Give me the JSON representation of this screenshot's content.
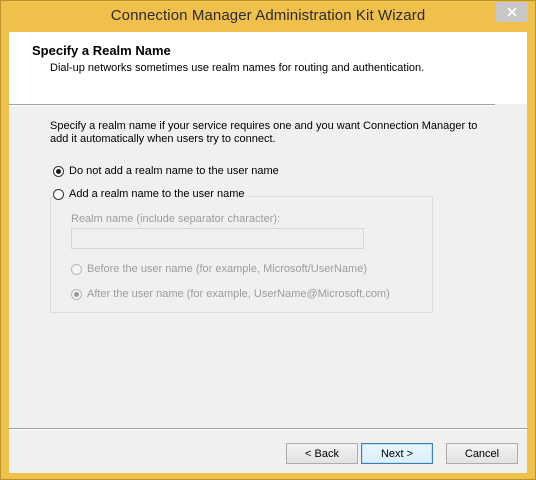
{
  "window": {
    "title": "Connection Manager Administration Kit Wizard",
    "close_symbol": "✕"
  },
  "header": {
    "title": "Specify a Realm Name",
    "subtitle": "Dial-up networks sometimes use realm names for routing and authentication."
  },
  "intro_text": "Specify a realm name if your service requires one and you want Connection Manager to add it automatically when users try to connect.",
  "options": {
    "no_realm": {
      "label": "Do not add a realm name to the user name",
      "checked": true
    },
    "add_realm": {
      "label": "Add a realm name to the user name",
      "checked": false
    }
  },
  "realm": {
    "label": "Realm name (include separator character):",
    "value": "",
    "before_label": "Before the user name (for example, Microsoft/UserName)",
    "after_label": "After the user name (for example, UserName@Microsoft.com)"
  },
  "buttons": {
    "back": "< Back",
    "next": "Next >",
    "cancel": "Cancel"
  },
  "colors": {
    "titlebar": "#f0c04c",
    "dialog_bg": "#f0f0f0",
    "disabled_text": "#9c9c9c"
  }
}
